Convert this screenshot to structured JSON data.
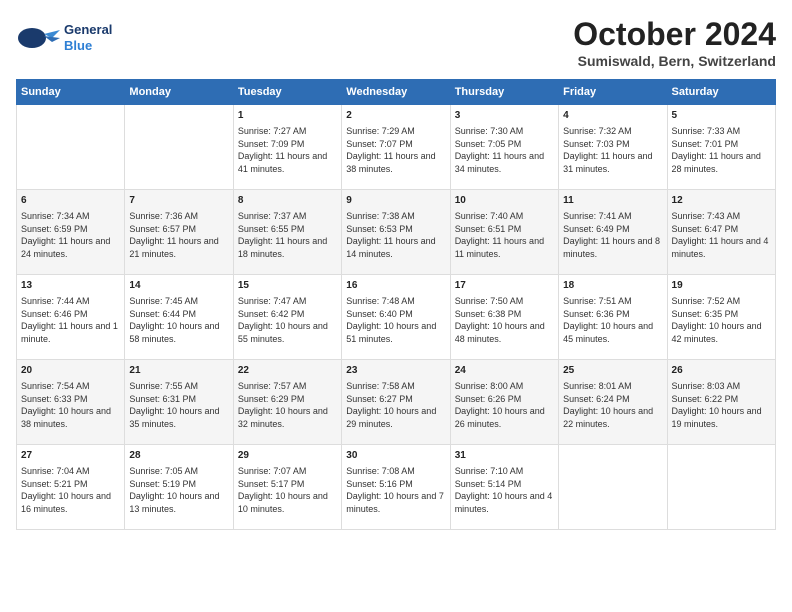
{
  "header": {
    "logo_line1": "General",
    "logo_line2": "Blue",
    "month": "October 2024",
    "location": "Sumiswald, Bern, Switzerland"
  },
  "days_of_week": [
    "Sunday",
    "Monday",
    "Tuesday",
    "Wednesday",
    "Thursday",
    "Friday",
    "Saturday"
  ],
  "weeks": [
    [
      {
        "day": "",
        "data": ""
      },
      {
        "day": "",
        "data": ""
      },
      {
        "day": "1",
        "data": "Sunrise: 7:27 AM\nSunset: 7:09 PM\nDaylight: 11 hours and 41 minutes."
      },
      {
        "day": "2",
        "data": "Sunrise: 7:29 AM\nSunset: 7:07 PM\nDaylight: 11 hours and 38 minutes."
      },
      {
        "day": "3",
        "data": "Sunrise: 7:30 AM\nSunset: 7:05 PM\nDaylight: 11 hours and 34 minutes."
      },
      {
        "day": "4",
        "data": "Sunrise: 7:32 AM\nSunset: 7:03 PM\nDaylight: 11 hours and 31 minutes."
      },
      {
        "day": "5",
        "data": "Sunrise: 7:33 AM\nSunset: 7:01 PM\nDaylight: 11 hours and 28 minutes."
      }
    ],
    [
      {
        "day": "6",
        "data": "Sunrise: 7:34 AM\nSunset: 6:59 PM\nDaylight: 11 hours and 24 minutes."
      },
      {
        "day": "7",
        "data": "Sunrise: 7:36 AM\nSunset: 6:57 PM\nDaylight: 11 hours and 21 minutes."
      },
      {
        "day": "8",
        "data": "Sunrise: 7:37 AM\nSunset: 6:55 PM\nDaylight: 11 hours and 18 minutes."
      },
      {
        "day": "9",
        "data": "Sunrise: 7:38 AM\nSunset: 6:53 PM\nDaylight: 11 hours and 14 minutes."
      },
      {
        "day": "10",
        "data": "Sunrise: 7:40 AM\nSunset: 6:51 PM\nDaylight: 11 hours and 11 minutes."
      },
      {
        "day": "11",
        "data": "Sunrise: 7:41 AM\nSunset: 6:49 PM\nDaylight: 11 hours and 8 minutes."
      },
      {
        "day": "12",
        "data": "Sunrise: 7:43 AM\nSunset: 6:47 PM\nDaylight: 11 hours and 4 minutes."
      }
    ],
    [
      {
        "day": "13",
        "data": "Sunrise: 7:44 AM\nSunset: 6:46 PM\nDaylight: 11 hours and 1 minute."
      },
      {
        "day": "14",
        "data": "Sunrise: 7:45 AM\nSunset: 6:44 PM\nDaylight: 10 hours and 58 minutes."
      },
      {
        "day": "15",
        "data": "Sunrise: 7:47 AM\nSunset: 6:42 PM\nDaylight: 10 hours and 55 minutes."
      },
      {
        "day": "16",
        "data": "Sunrise: 7:48 AM\nSunset: 6:40 PM\nDaylight: 10 hours and 51 minutes."
      },
      {
        "day": "17",
        "data": "Sunrise: 7:50 AM\nSunset: 6:38 PM\nDaylight: 10 hours and 48 minutes."
      },
      {
        "day": "18",
        "data": "Sunrise: 7:51 AM\nSunset: 6:36 PM\nDaylight: 10 hours and 45 minutes."
      },
      {
        "day": "19",
        "data": "Sunrise: 7:52 AM\nSunset: 6:35 PM\nDaylight: 10 hours and 42 minutes."
      }
    ],
    [
      {
        "day": "20",
        "data": "Sunrise: 7:54 AM\nSunset: 6:33 PM\nDaylight: 10 hours and 38 minutes."
      },
      {
        "day": "21",
        "data": "Sunrise: 7:55 AM\nSunset: 6:31 PM\nDaylight: 10 hours and 35 minutes."
      },
      {
        "day": "22",
        "data": "Sunrise: 7:57 AM\nSunset: 6:29 PM\nDaylight: 10 hours and 32 minutes."
      },
      {
        "day": "23",
        "data": "Sunrise: 7:58 AM\nSunset: 6:27 PM\nDaylight: 10 hours and 29 minutes."
      },
      {
        "day": "24",
        "data": "Sunrise: 8:00 AM\nSunset: 6:26 PM\nDaylight: 10 hours and 26 minutes."
      },
      {
        "day": "25",
        "data": "Sunrise: 8:01 AM\nSunset: 6:24 PM\nDaylight: 10 hours and 22 minutes."
      },
      {
        "day": "26",
        "data": "Sunrise: 8:03 AM\nSunset: 6:22 PM\nDaylight: 10 hours and 19 minutes."
      }
    ],
    [
      {
        "day": "27",
        "data": "Sunrise: 7:04 AM\nSunset: 5:21 PM\nDaylight: 10 hours and 16 minutes."
      },
      {
        "day": "28",
        "data": "Sunrise: 7:05 AM\nSunset: 5:19 PM\nDaylight: 10 hours and 13 minutes."
      },
      {
        "day": "29",
        "data": "Sunrise: 7:07 AM\nSunset: 5:17 PM\nDaylight: 10 hours and 10 minutes."
      },
      {
        "day": "30",
        "data": "Sunrise: 7:08 AM\nSunset: 5:16 PM\nDaylight: 10 hours and 7 minutes."
      },
      {
        "day": "31",
        "data": "Sunrise: 7:10 AM\nSunset: 5:14 PM\nDaylight: 10 hours and 4 minutes."
      },
      {
        "day": "",
        "data": ""
      },
      {
        "day": "",
        "data": ""
      }
    ]
  ]
}
